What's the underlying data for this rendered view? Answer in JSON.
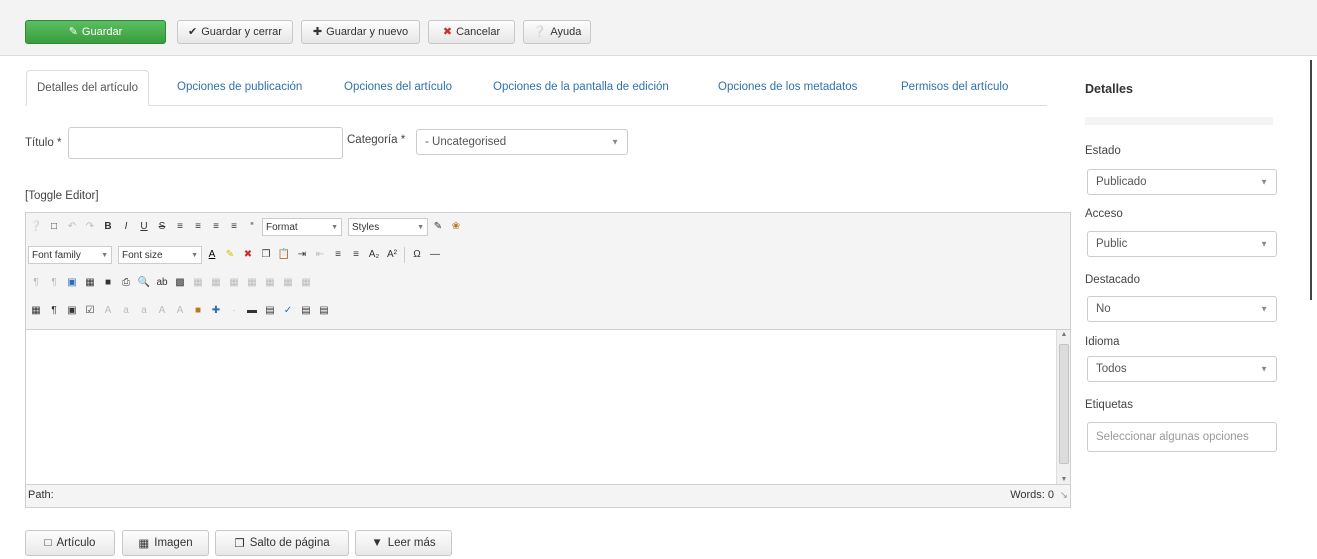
{
  "toolbar": {
    "save": "Guardar",
    "save_close": "Guardar y cerrar",
    "save_new": "Guardar y nuevo",
    "cancel": "Cancelar",
    "help": "Ayuda"
  },
  "tabs": [
    {
      "label": "Detalles del artículo",
      "active": true
    },
    {
      "label": "Opciones de publicación",
      "active": false
    },
    {
      "label": "Opciones del artículo",
      "active": false
    },
    {
      "label": "Opciones de la pantalla de edición",
      "active": false
    },
    {
      "label": "Opciones de los metadatos",
      "active": false
    },
    {
      "label": "Permisos del artículo",
      "active": false
    }
  ],
  "form": {
    "title_label": "Título *",
    "title_value": "",
    "category_label": "Categoría *",
    "category_value": "- Uncategorised",
    "toggle_editor": "[Toggle Editor]"
  },
  "editor": {
    "format": "Format",
    "styles": "Styles",
    "font_family": "Font family",
    "font_size": "Font size",
    "path": "Path:",
    "words": "Words: 0"
  },
  "bottom_buttons": {
    "article": "Artículo",
    "image": "Imagen",
    "page_break": "Salto de página",
    "read_more": "Leer más"
  },
  "sidebar": {
    "title": "Detalles",
    "fields": [
      {
        "label": "Estado",
        "value": "Publicado"
      },
      {
        "label": "Acceso",
        "value": "Public"
      },
      {
        "label": "Destacado",
        "value": "No"
      },
      {
        "label": "Idioma",
        "value": "Todos"
      }
    ],
    "tags_label": "Etiquetas",
    "tags_placeholder": "Seleccionar algunas opciones"
  },
  "colors": {
    "primary": "#46a54b",
    "link": "#3071a9"
  }
}
